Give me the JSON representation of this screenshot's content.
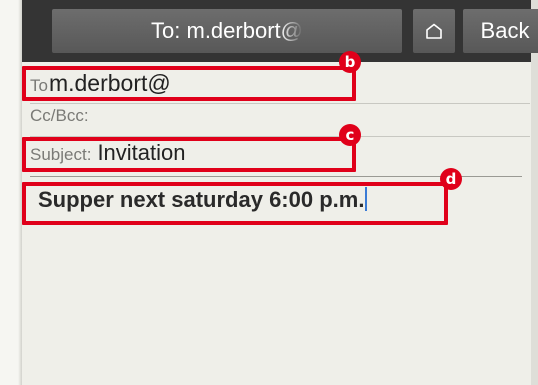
{
  "header": {
    "to_button_label": "To: m.derbort@",
    "home_icon": "home-icon",
    "back_label": "Back"
  },
  "fields": {
    "to_label": "To",
    "to_value": "m.derbort@",
    "cc_label": "Cc/Bcc:",
    "subject_label": "Subject:",
    "subject_value": "Invitation"
  },
  "body": {
    "text": "Supper next saturday 6:00 p.m."
  },
  "callouts": {
    "b": "b",
    "c": "c",
    "d": "d"
  },
  "colors": {
    "header_bg": "#343434",
    "button_bg": "#606060",
    "highlight": "#e0001a",
    "caret": "#3a7bd5",
    "page_bg": "#efefe9"
  }
}
